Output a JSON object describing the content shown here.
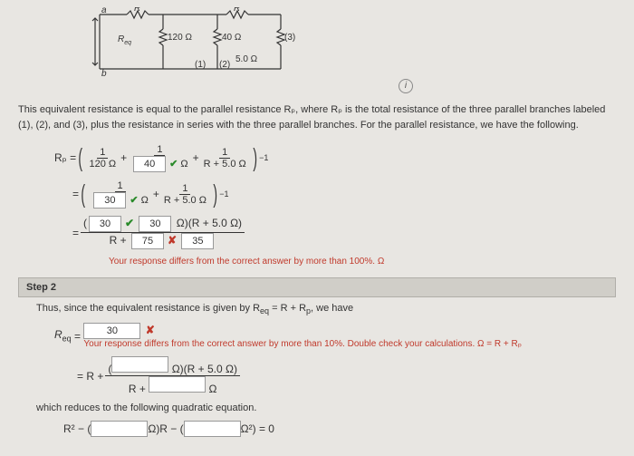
{
  "circuit": {
    "r_top_left": "R",
    "r_top_right": "R",
    "req": "R",
    "req_sub": "eq",
    "r120": "120 Ω",
    "r40": "40 Ω",
    "r5": "5.0 Ω",
    "label1": "(1)",
    "label2": "(2)",
    "label3": "(3)",
    "node_a": "a",
    "node_b": "b"
  },
  "intro": "This equivalent resistance is equal to the parallel resistance Rₚ, where Rₚ is the total resistance of the three parallel branches labeled (1), (2), and (3), plus the resistance in series with the three parallel branches. For the parallel resistance, we have the following.",
  "eq1": {
    "lhs": "Rₚ =",
    "f1_num": "1",
    "f1_den": "120 Ω",
    "plus1": "+",
    "ans1": "40",
    "f2_num": "1",
    "f2_den_suffix": "Ω",
    "plus2": "+",
    "f3_num": "1",
    "f3_den": "R + 5.0 Ω",
    "exp": "−1"
  },
  "eq2": {
    "eq": "=",
    "ans1": "30",
    "f1_num": "1",
    "f1_suffix": "Ω",
    "plus": "+",
    "f2_num": "1",
    "f2_den": "R + 5.0 Ω",
    "exp": "−1"
  },
  "eq3": {
    "eq": "=",
    "ans_top1": "30",
    "ans_top2": "30",
    "top_suffix": "Ω)(R + 5.0 Ω)",
    "bot_pre": "R +",
    "ans_bot1": "75",
    "ans_bot2": "35",
    "feedback": "Your response differs from the correct answer by more than 100%. Ω"
  },
  "step2": {
    "header": "Step 2",
    "line1_a": "Thus, since the equivalent resistance is given by R",
    "line1_b": " = R + R",
    "line1_c": ", we have",
    "req_lbl": "R",
    "req_sub": "eq",
    "eq": "=",
    "ans1": "30",
    "feedback": "Your response differs from the correct answer by more than 10%. Double check your calculations. Ω = R + Rₚ",
    "eq2_pre": "= R +",
    "eq2_top_suffix": "Ω)(R + 5.0 Ω)",
    "eq2_bot_pre": "R +",
    "eq2_bot_suffix": "Ω",
    "reduce": "which reduces to the following quadratic equation.",
    "quad_lhs": "R² − (",
    "quad_mid_suffix": "Ω)R − (",
    "quad_end": "Ω²) = 0"
  }
}
